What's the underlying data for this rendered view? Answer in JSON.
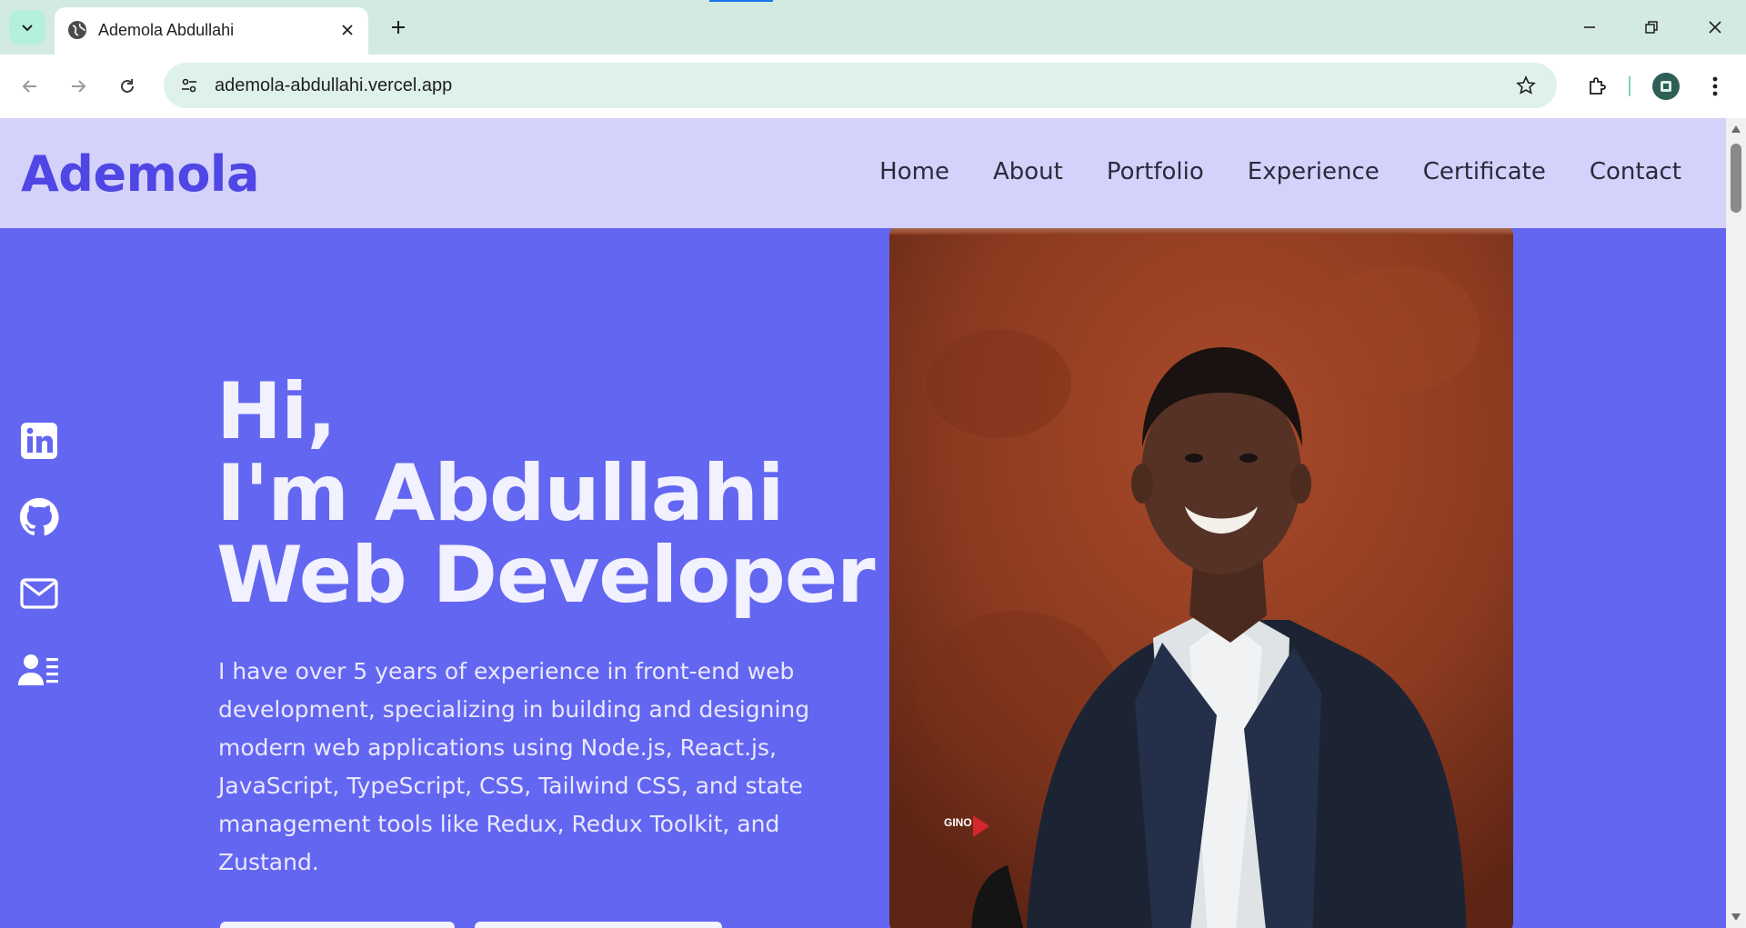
{
  "browser": {
    "tab_title": "Ademola Abdullahi",
    "url": "ademola-abdullahi.vercel.app",
    "colors": {
      "tabstrip": "#d3eae0",
      "omnibox": "#dff2ea"
    }
  },
  "site": {
    "logo": "Ademola",
    "nav": [
      "Home",
      "About",
      "Portfolio",
      "Experience",
      "Certificate",
      "Contact"
    ],
    "social_icons": [
      "linkedin-icon",
      "github-icon",
      "mail-icon",
      "resume-icon"
    ],
    "hero": {
      "line1": "Hi,",
      "line2": "I'm Abdullahi",
      "line3": "Web Developer",
      "description": "I have over 5 years of experience in front-end web development, specializing in building and designing modern web applications using Node.js, React.js, JavaScript, TypeScript, CSS, Tailwind CSS, and state management tools like Redux, Redux Toolkit, and Zustand."
    },
    "photo_watermark": "GINO",
    "colors": {
      "accent": "#6366f1",
      "navbar": "#d4d1fb",
      "logo": "#4f46e5"
    }
  }
}
